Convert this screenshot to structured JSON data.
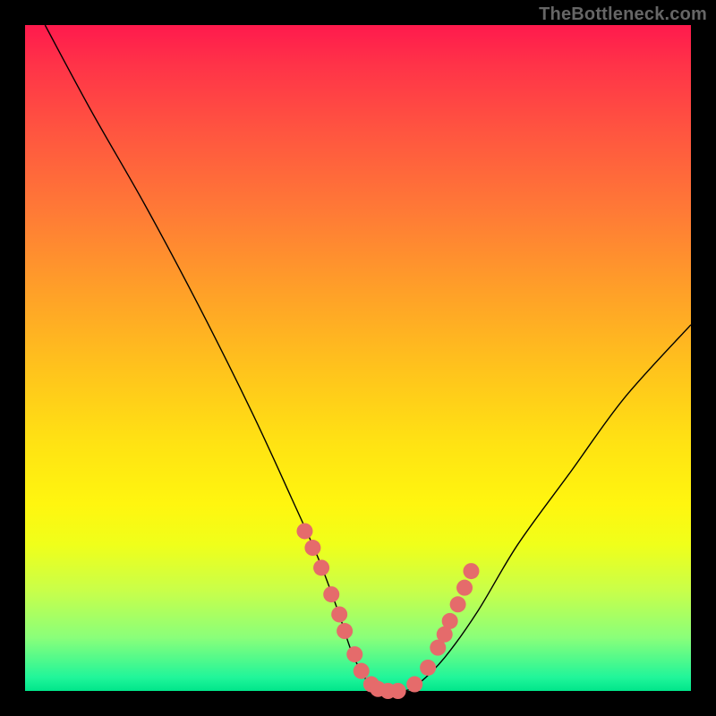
{
  "watermark": "TheBottleneck.com",
  "colors": {
    "page_bg": "#000000",
    "gradient_top": "#ff1a4d",
    "gradient_bottom": "#00e68a",
    "curve_stroke": "#000000",
    "marker_fill": "#e56b6b",
    "watermark_text": "#666666"
  },
  "chart_data": {
    "type": "line",
    "title": "",
    "xlabel": "",
    "ylabel": "",
    "x_range": [
      0,
      100
    ],
    "y_range": [
      0,
      100
    ],
    "grid": false,
    "legend": false,
    "series": [
      {
        "name": "bottleneck-curve",
        "x": [
          3,
          10,
          18,
          26,
          34,
          40,
          44,
          47,
          49,
          51,
          53,
          55,
          57,
          59,
          63,
          68,
          74,
          82,
          90,
          100
        ],
        "y": [
          100,
          87,
          73,
          58,
          42,
          29,
          20,
          12,
          6,
          2,
          0,
          0,
          0,
          1,
          5,
          12,
          22,
          33,
          44,
          55
        ]
      }
    ],
    "markers": {
      "description": "highlighted points near curve minimum",
      "x": [
        42.0,
        43.2,
        44.5,
        46.0,
        47.2,
        48.0,
        49.5,
        50.5,
        52.0,
        53.0,
        54.5,
        56.0,
        58.5,
        60.5,
        62.0,
        63.0,
        63.8,
        65.0,
        66.0,
        67.0
      ],
      "y": [
        24.0,
        21.5,
        18.5,
        14.5,
        11.5,
        9.0,
        5.5,
        3.0,
        1.0,
        0.3,
        0.0,
        0.0,
        1.0,
        3.5,
        6.5,
        8.5,
        10.5,
        13.0,
        15.5,
        18.0
      ]
    }
  }
}
